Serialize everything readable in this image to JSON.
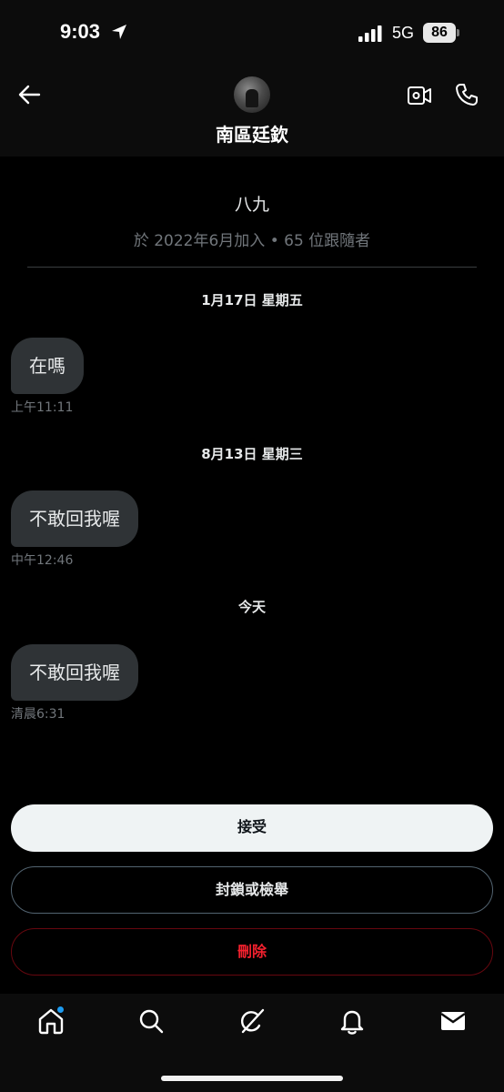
{
  "status_bar": {
    "time": "9:03",
    "network": "5G",
    "battery": "86"
  },
  "header": {
    "name": "南區廷欽"
  },
  "profile": {
    "handle": "八九",
    "meta": "於 2022年6月加入 • 65 位跟隨者"
  },
  "conversation": [
    {
      "date": "1月17日 星期五",
      "message": "在嗎",
      "time": "上午11:11"
    },
    {
      "date": "8月13日 星期三",
      "message": "不敢回我喔",
      "time": "中午12:46"
    },
    {
      "date": "今天",
      "message": "不敢回我喔",
      "time": "清晨6:31"
    }
  ],
  "actions": {
    "accept": "接受",
    "block_report": "封鎖或檢舉",
    "delete": "刪除"
  },
  "colors": {
    "background": "#000000",
    "bubble": "#2f3336",
    "muted_text": "#71767b",
    "delete_red": "#f4212e",
    "accent_blue": "#1d9bf0"
  },
  "icons": {
    "status": [
      "location-arrow-icon",
      "signal-icon",
      "battery-icon"
    ],
    "header": [
      "back-arrow-icon",
      "video-call-icon",
      "phone-call-icon"
    ],
    "nav": [
      "home-icon",
      "search-icon",
      "grok-icon",
      "bell-icon",
      "mail-icon"
    ]
  }
}
